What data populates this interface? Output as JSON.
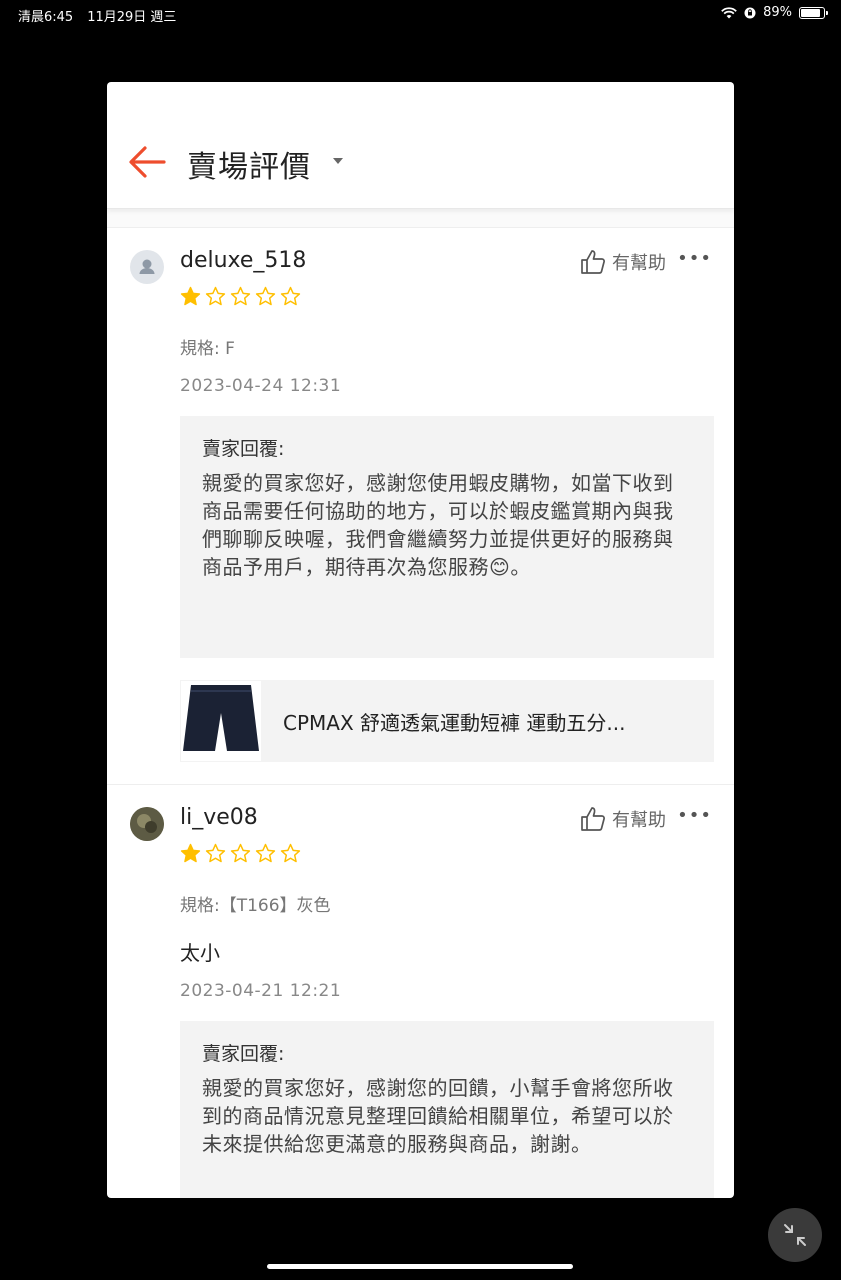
{
  "status_bar": {
    "time": "清晨6:45",
    "date": "11月29日 週三",
    "battery": "89%",
    "battery_level": 0.89
  },
  "header": {
    "title": "賣場評價"
  },
  "reviews": [
    {
      "username": "deluxe_518",
      "helpful_label": "有幫助",
      "rating": 1,
      "max_rating": 5,
      "spec": "規格: F",
      "comment": "",
      "date": "2023-04-24 12:31",
      "reply_title": "賣家回覆:",
      "reply_text": "親愛的買家您好，感謝您使用蝦皮購物，如當下收到商品需要任何協助的地方，可以於蝦皮鑑賞期內與我們聊聊反映喔，我們會繼續努力並提供更好的服務與商品予用戶，期待再次為您服務😊。",
      "product_name": "CPMAX 舒適透氣運動短褲 運動五分..."
    },
    {
      "username": "li_ve08",
      "helpful_label": "有幫助",
      "rating": 1,
      "max_rating": 5,
      "spec": "規格:【T166】灰色",
      "comment": "太小",
      "date": "2023-04-21 12:21",
      "reply_title": "賣家回覆:",
      "reply_text": "親愛的買家您好，感謝您的回饋，小幫手會將您所收到的商品情況意見整理回饋給相關單位，希望可以於未來提供給您更滿意的服務與商品，謝謝。"
    }
  ],
  "colors": {
    "accent": "#ee4d2d",
    "star": "#ffbf00",
    "reply_bg": "#f3f3f3"
  }
}
